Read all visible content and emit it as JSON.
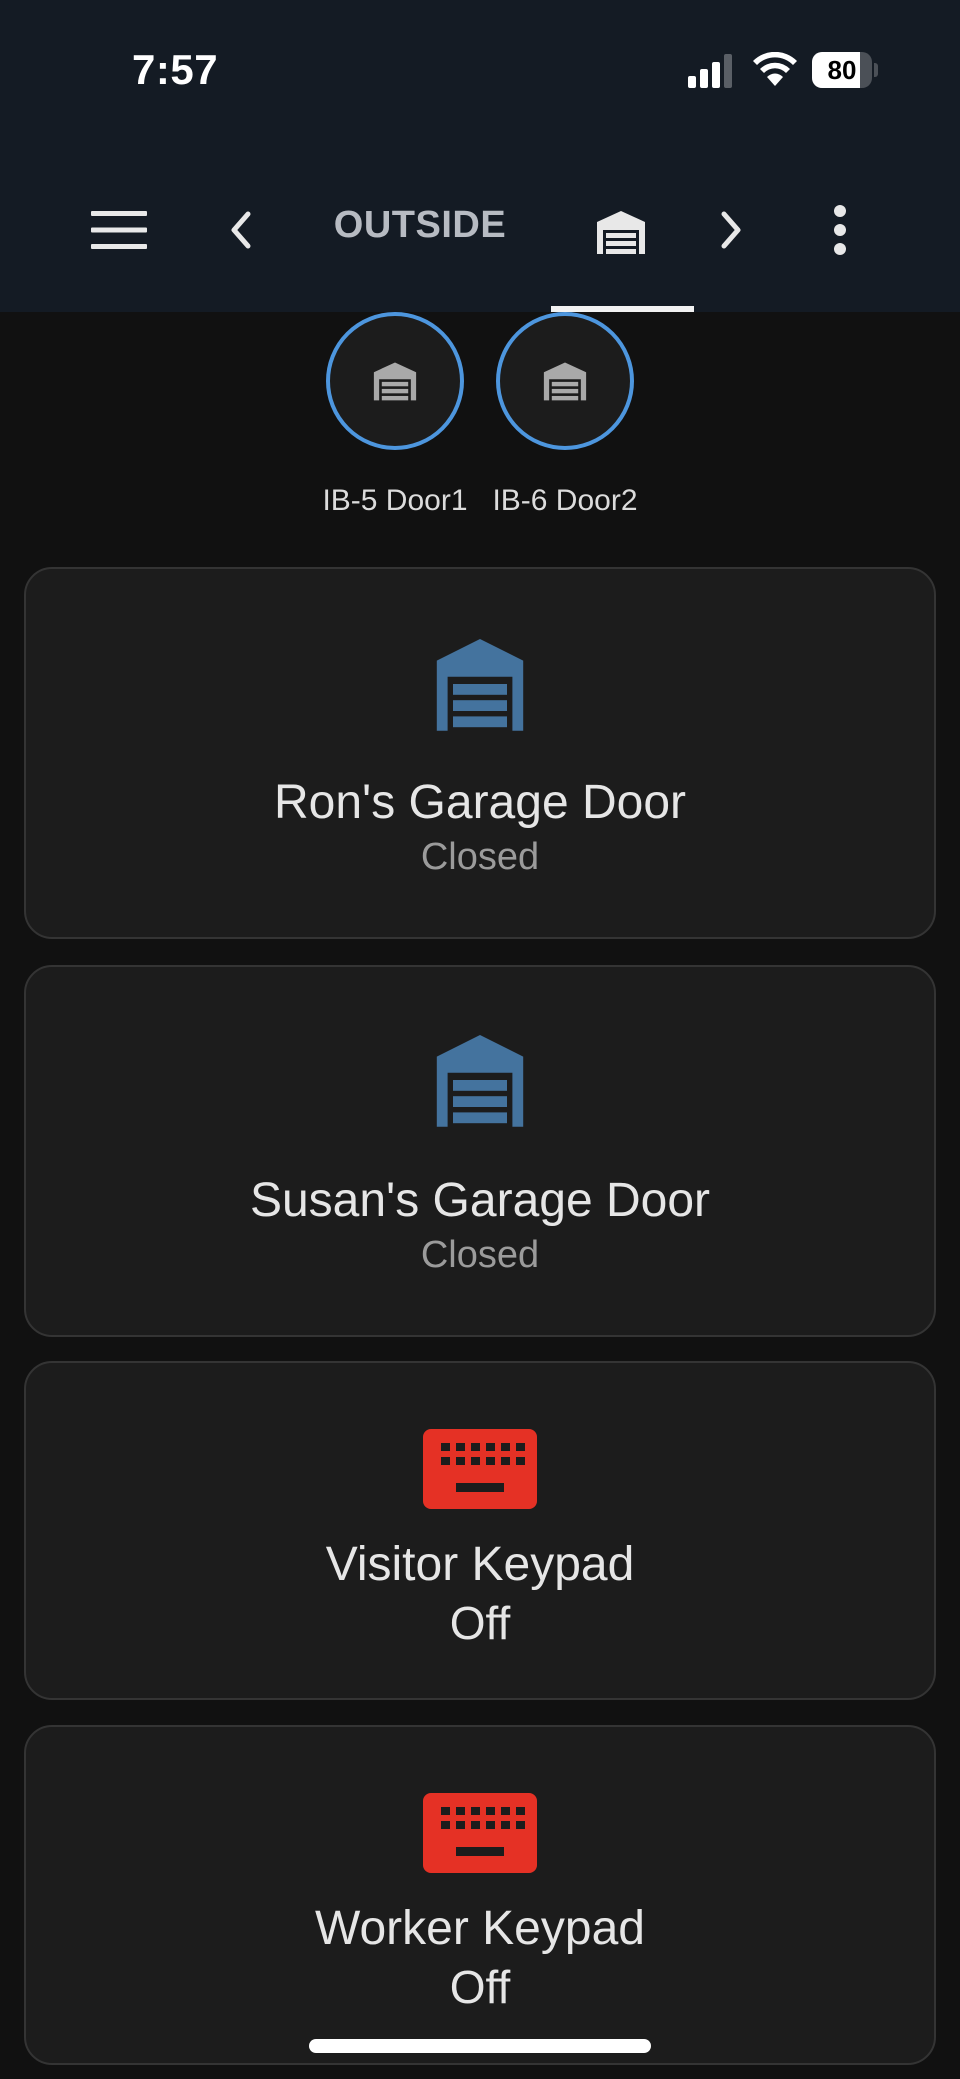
{
  "status_bar": {
    "time": "7:57",
    "battery_level": "80",
    "battery_fraction": 0.8
  },
  "toolbar": {
    "menu_icon": "hamburger-menu-icon",
    "prev_icon": "chevron-left-icon",
    "view_title": "OUTSIDE",
    "active_view_icon": "garage-icon",
    "next_icon": "chevron-right-icon",
    "overflow_icon": "dots-vertical-icon",
    "underline_color": "#f2f2f2"
  },
  "badges": [
    {
      "label": "IB-5 Door1",
      "icon": "garage-icon"
    },
    {
      "label": "IB-6 Door2",
      "icon": "garage-icon"
    }
  ],
  "cards": [
    {
      "name": "Ron's Garage Door",
      "state": "Closed",
      "icon": "garage-icon",
      "icon_color": "#44739e"
    },
    {
      "name": "Susan's Garage Door",
      "state": "Closed",
      "icon": "garage-icon",
      "icon_color": "#44739e"
    },
    {
      "name": "Visitor Keypad",
      "state": "Off",
      "icon": "keyboard-icon",
      "icon_color": "#e53125"
    },
    {
      "name": "Worker Keypad",
      "state": "Off",
      "icon": "keyboard-icon",
      "icon_color": "#e53125"
    }
  ],
  "colors": {
    "background": "#111111",
    "header": "#141b24",
    "card": "#1c1c1c",
    "badge_ring": "#4d96de"
  }
}
